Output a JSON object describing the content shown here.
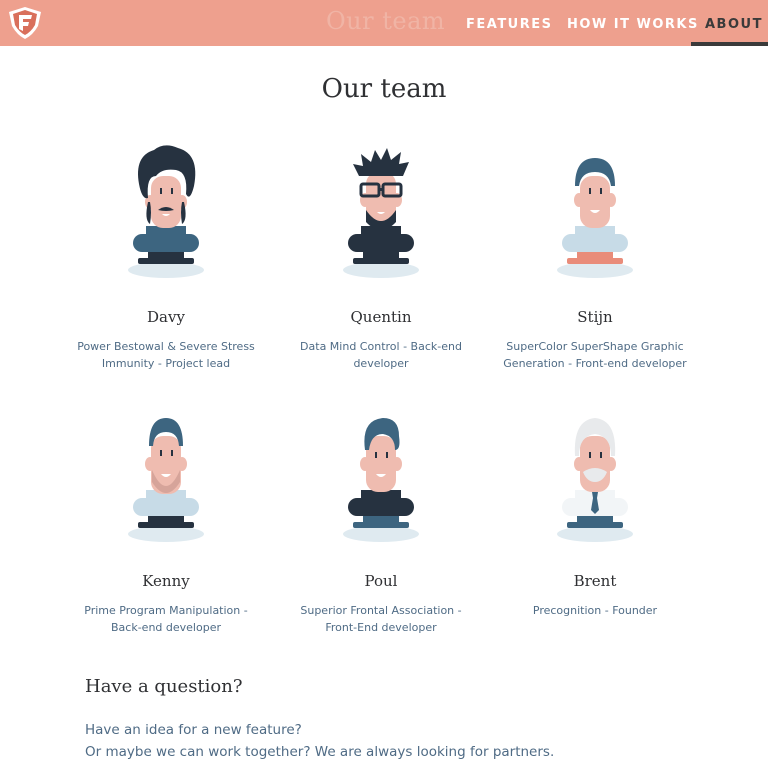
{
  "brand": {
    "logo_icon": "shield-f-logo-icon",
    "nav_title": "Our team"
  },
  "nav": {
    "links": [
      {
        "label": "FEATURES"
      },
      {
        "label": "HOW IT WORKS"
      },
      {
        "label": "ABOUT",
        "active": true
      }
    ]
  },
  "page": {
    "title": "Our team"
  },
  "team": [
    {
      "name": "Davy",
      "role": "Power Bestowal & Severe Stress Immunity - Project lead",
      "role_lines": [
        "Power Bestowal & Severe Stress",
        "Immunity - Project lead"
      ],
      "avatar_icon": "curly-hair-mustache-avatar-icon"
    },
    {
      "name": "Quentin",
      "role": "Data Mind Control - Back-end developer",
      "role_lines": [
        "Data Mind Control - Back-end",
        "developer"
      ],
      "avatar_icon": "spiky-hair-glasses-avatar-icon"
    },
    {
      "name": "Stijn",
      "role": "SuperColor SuperShape Graphic Generation - Front-end developer",
      "role_lines": [
        "SuperColor SuperShape Graphic",
        "Generation - Front-end developer"
      ],
      "avatar_icon": "beanie-avatar-icon"
    },
    {
      "name": "Kenny",
      "role": "Prime Program Manipulation - Back-end developer",
      "role_lines": [
        "Prime Program Manipulation -",
        "Back-end developer"
      ],
      "avatar_icon": "beard-avatar-icon"
    },
    {
      "name": "Poul",
      "role": "Superior Frontal Association - Front-End developer",
      "role_lines": [
        "Superior Frontal Association -",
        "Front-End developer"
      ],
      "avatar_icon": "quiff-avatar-icon"
    },
    {
      "name": "Brent",
      "role": "Precognition - Founder",
      "role_lines": [
        "Precognition - Founder"
      ],
      "avatar_icon": "white-hair-tie-avatar-icon"
    }
  ],
  "question": {
    "title": "Have a question?",
    "lines": [
      "Have an idea for a new feature?",
      "Or maybe we can work together? We are always looking for partners."
    ]
  },
  "colors": {
    "navbar": "#eea08e",
    "skin": "#efbcb0",
    "dark": "#263240",
    "teal": "#3d6580",
    "light_blue": "#c7dbe7",
    "coral": "#e98c7a",
    "text_blue": "#4f6b85"
  }
}
